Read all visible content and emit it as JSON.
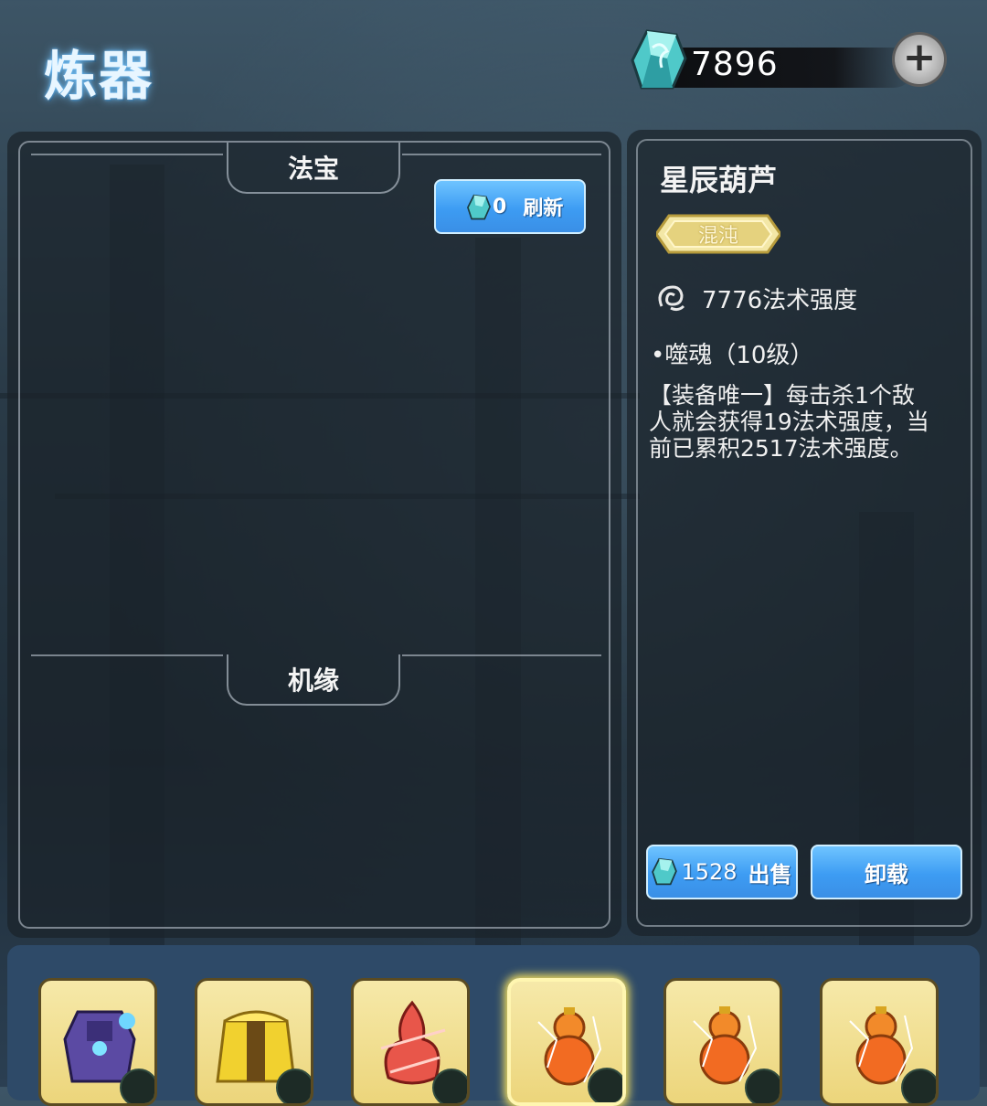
{
  "header": {
    "title": "炼器",
    "currency_amount": "7896",
    "add_label": "+"
  },
  "left_panel": {
    "treasure_section": "法宝",
    "refresh_cost": "0",
    "refresh_label": "刷新",
    "fortune_section": "机缘"
  },
  "detail": {
    "item_name": "星辰葫芦",
    "rarity": "混沌",
    "stat": "7776法术强度",
    "skill_name": "•噬魂（10级）",
    "skill_desc": "【装备唯一】每击杀1个敌人就会获得19法术强度，当前已累积2517法术强度。",
    "sell_price": "1528",
    "sell_label": "出售",
    "unequip_label": "卸载"
  },
  "inventory": [
    {
      "icon": "armor-golem-icon",
      "selected": false
    },
    {
      "icon": "golden-robe-icon",
      "selected": false
    },
    {
      "icon": "flame-spirit-icon",
      "selected": false
    },
    {
      "icon": "star-gourd-icon",
      "selected": true
    },
    {
      "icon": "star-gourd-icon",
      "selected": false
    },
    {
      "icon": "star-gourd-icon",
      "selected": false
    }
  ],
  "colors": {
    "accent_blue": "#3d9cf3",
    "rarity_gold": "#e9d98a",
    "slot_gold": "#ecd57b"
  }
}
